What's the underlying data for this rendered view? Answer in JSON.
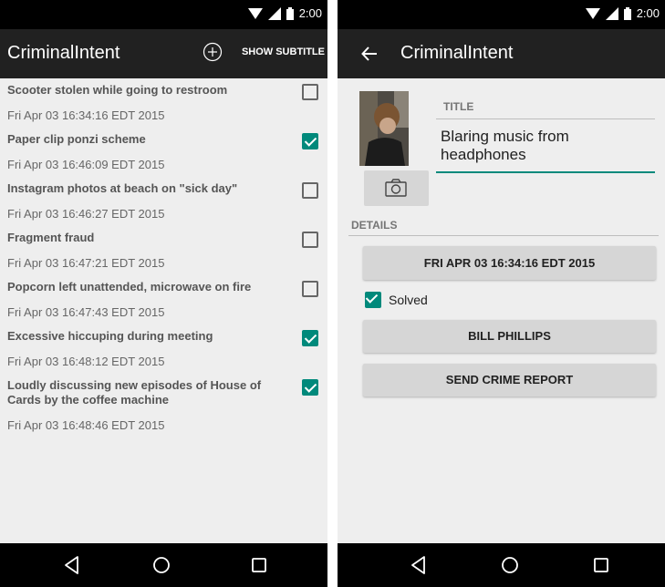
{
  "status_bar": {
    "time": "2:00"
  },
  "crime_list_screen": {
    "app_title": "CriminalIntent",
    "show_subtitle_label": "SHOW SUBTITLE",
    "crimes": [
      {
        "title": "Scooter stolen while going to restroom",
        "date": "Fri Apr 03 16:34:16 EDT 2015",
        "solved": false
      },
      {
        "title": "Paper clip ponzi scheme",
        "date": "Fri Apr 03 16:46:09 EDT 2015",
        "solved": true
      },
      {
        "title": "Instagram photos at beach on \"sick day\"",
        "date": "Fri Apr 03 16:46:27 EDT 2015",
        "solved": false
      },
      {
        "title": "Fragment fraud",
        "date": "Fri Apr 03 16:47:21 EDT 2015",
        "solved": false
      },
      {
        "title": "Popcorn left unattended, microwave on fire",
        "date": "Fri Apr 03 16:47:43 EDT 2015",
        "solved": false
      },
      {
        "title": "Excessive hiccuping during meeting",
        "date": "Fri Apr 03 16:48:12 EDT 2015",
        "solved": true
      },
      {
        "title": "Loudly discussing new episodes of House of Cards by the coffee machine",
        "date": "Fri Apr 03 16:48:46 EDT 2015",
        "solved": true
      }
    ]
  },
  "crime_detail_screen": {
    "app_title": "CriminalIntent",
    "title_label": "TITLE",
    "title_value": "Blaring music from headphones",
    "details_label": "DETAILS",
    "date_button": "FRI APR 03 16:34:16 EDT 2015",
    "solved_label": "Solved",
    "solved": true,
    "suspect_button": "BILL PHILLIPS",
    "report_button": "SEND CRIME REPORT"
  },
  "colors": {
    "accent": "#00897b",
    "app_bar": "#212121",
    "background": "#eeeeee",
    "button": "#d6d6d6"
  }
}
